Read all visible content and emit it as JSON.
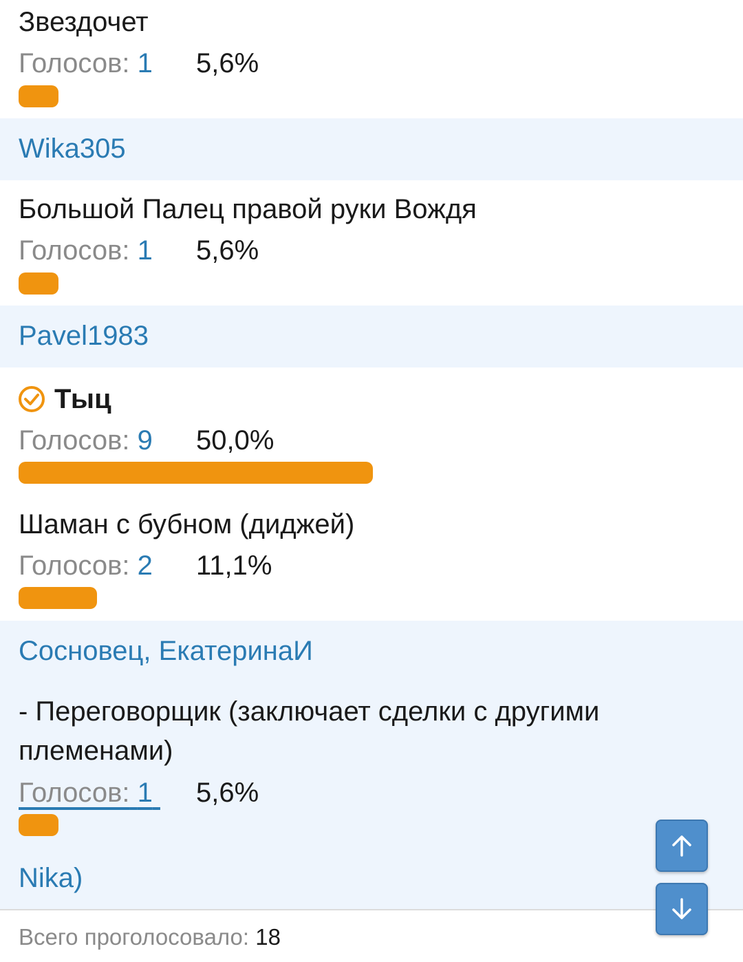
{
  "poll": {
    "options": [
      {
        "title": "Звездочет",
        "votes_label": "Голосов:",
        "votes": "1",
        "percent": "5,6%",
        "fraction": 0.056,
        "voters": "Wika305"
      },
      {
        "title": "Большой Палец правой руки Вождя",
        "votes_label": "Голосов:",
        "votes": "1",
        "percent": "5,6%",
        "fraction": 0.056,
        "voters": "Pavel1983"
      },
      {
        "title": "Тыц",
        "selected": true,
        "votes_label": "Голосов:",
        "votes": "9",
        "percent": "50,0%",
        "fraction": 0.5
      },
      {
        "title": "Шаман с бубном (диджей)",
        "votes_label": "Голосов:",
        "votes": "2",
        "percent": "11,1%",
        "fraction": 0.111,
        "voters": "Сосновец, ЕкатеринаИ"
      },
      {
        "title": "- Переговорщик (заключает сделки с другими племенами)",
        "votes_label": "Голосов:",
        "votes": "1",
        "percent": "5,6%",
        "fraction": 0.056,
        "voters": "Nika)"
      }
    ],
    "total_label": "Всего проголосовало:",
    "total": "18"
  },
  "colors": {
    "bar": "#f0940f",
    "link": "#2a7bb3",
    "voters_bg": "#eef5fd",
    "scroll_button": "#4f8fcc"
  },
  "icons": {
    "selected": "check-circle-icon",
    "scroll_up": "arrow-up-icon",
    "scroll_down": "arrow-down-icon"
  }
}
